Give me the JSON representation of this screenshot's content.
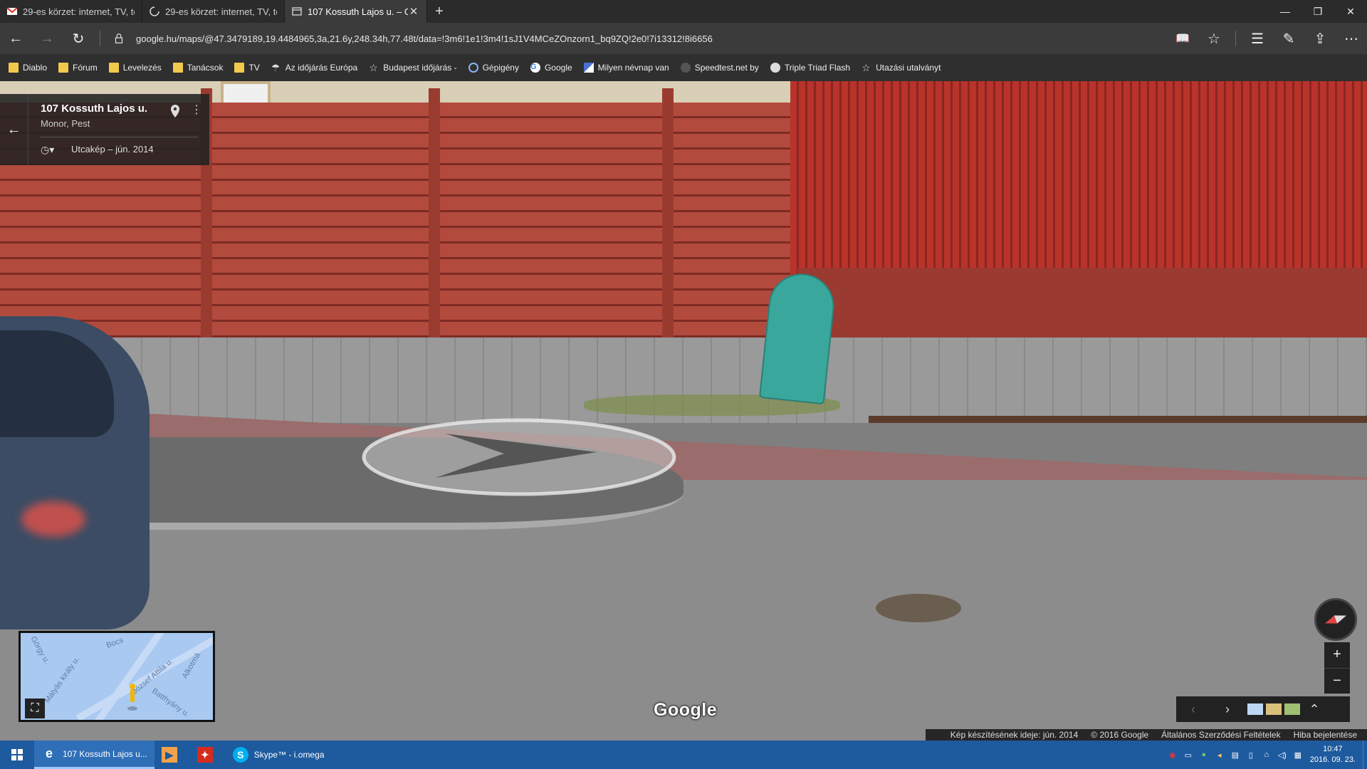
{
  "browser": {
    "tabs": [
      {
        "title": "29-es körzet: internet, TV, te",
        "icon": "gmail-icon",
        "active": false
      },
      {
        "title": "29-es körzet: internet, TV, te",
        "icon": "loading-icon",
        "active": false
      },
      {
        "title": "107 Kossuth Lajos u. – G",
        "icon": "page-icon",
        "active": true
      }
    ],
    "new_tab": "+",
    "url": "google.hu/maps/@47.3479189,19.4484965,3a,21.6y,248.34h,77.48t/data=!3m6!1e1!3m4!1sJ1V4MCeZOnzorn1_bq9ZQ!2e0!7i13312!8i6656",
    "favorites": [
      {
        "label": "Diablo",
        "icon": "folder-icon"
      },
      {
        "label": "Fórum",
        "icon": "folder-icon"
      },
      {
        "label": "Levelezés",
        "icon": "folder-icon"
      },
      {
        "label": "Tanácsok",
        "icon": "folder-icon"
      },
      {
        "label": "TV",
        "icon": "folder-icon"
      },
      {
        "label": "Az időjárás Európa",
        "icon": "weather-icon"
      },
      {
        "label": "Budapest időjárás -",
        "icon": "star-icon"
      },
      {
        "label": "Gépigény",
        "icon": "cog-icon"
      },
      {
        "label": "Google",
        "icon": "google-icon"
      },
      {
        "label": "Milyen névnap van",
        "icon": "flag-icon"
      },
      {
        "label": "Speedtest.net by",
        "icon": "speedtest-icon"
      },
      {
        "label": "Triple Triad Flash",
        "icon": "triad-icon"
      },
      {
        "label": "Utazási utalványt",
        "icon": "star-icon"
      }
    ]
  },
  "streetview": {
    "address": "107 Kossuth Lajos u.",
    "city": "Monor, Pest",
    "capture": "Utcakép – jún. 2014",
    "minimap_labels": [
      "Görgy u.",
      "Mátyás király u.",
      "Bocs",
      "József Attila u.",
      "Alkotmá",
      "Batthyány u."
    ],
    "logo": "Google",
    "footer": [
      "Kép készítésének ideje: jún. 2014",
      "© 2016 Google",
      "Általános Szerződési Feltételek",
      "Hiba bejelentése"
    ],
    "zoom_in": "+",
    "zoom_out": "−"
  },
  "taskbar": {
    "apps": [
      {
        "label": "107 Kossuth Lajos u...",
        "icon": "edge-icon",
        "active": true
      },
      {
        "label": "",
        "icon": "media-player-icon",
        "active": false
      },
      {
        "label": "",
        "icon": "canada-flag-icon",
        "active": false
      },
      {
        "label": "Skype™ - i.omega",
        "icon": "skype-icon",
        "active": false
      }
    ],
    "time": "10:47",
    "date": "2016. 09. 23."
  },
  "colors": {
    "tabbar": "#2b2b2b",
    "addressbar": "#3b3b3b",
    "favbar": "#2f2f2f",
    "taskbar": "#1e5a9e",
    "fence_red": "#b34a3e",
    "cabinet_teal": "#3aa79c"
  }
}
